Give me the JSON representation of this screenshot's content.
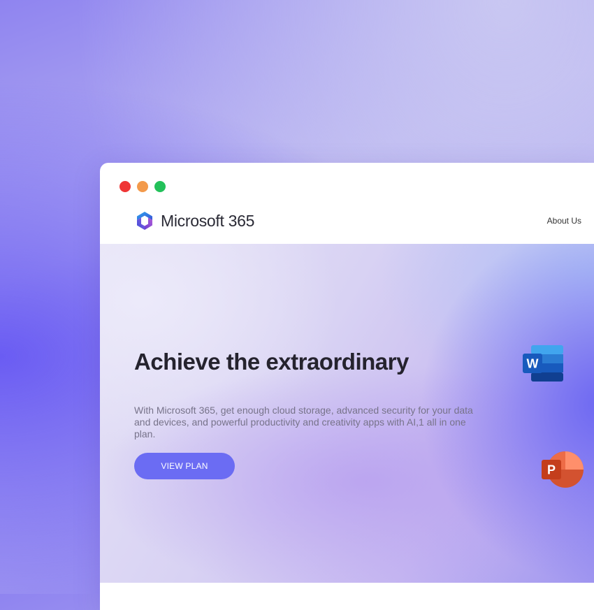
{
  "window_controls": {
    "close_color": "#ef3535",
    "minimize_color": "#f39a4b",
    "maximize_color": "#23c15a"
  },
  "navbar": {
    "brand_name": "Microsoft 365",
    "brand_icon": "microsoft-365-logo-icon",
    "links": [
      {
        "label": "About Us"
      }
    ]
  },
  "hero": {
    "title": "Achieve the extraordinary",
    "description": "With Microsoft 365, get enough cloud storage, advanced security for your data and devices, and powerful productivity and creativity apps with AI,1 all in one plan.",
    "cta_label": "VIEW PLAN",
    "cta_color": "#6b6cf3"
  },
  "floating_icons": [
    {
      "name": "word-icon",
      "letter": "W"
    },
    {
      "name": "powerpoint-icon",
      "letter": "P"
    }
  ]
}
